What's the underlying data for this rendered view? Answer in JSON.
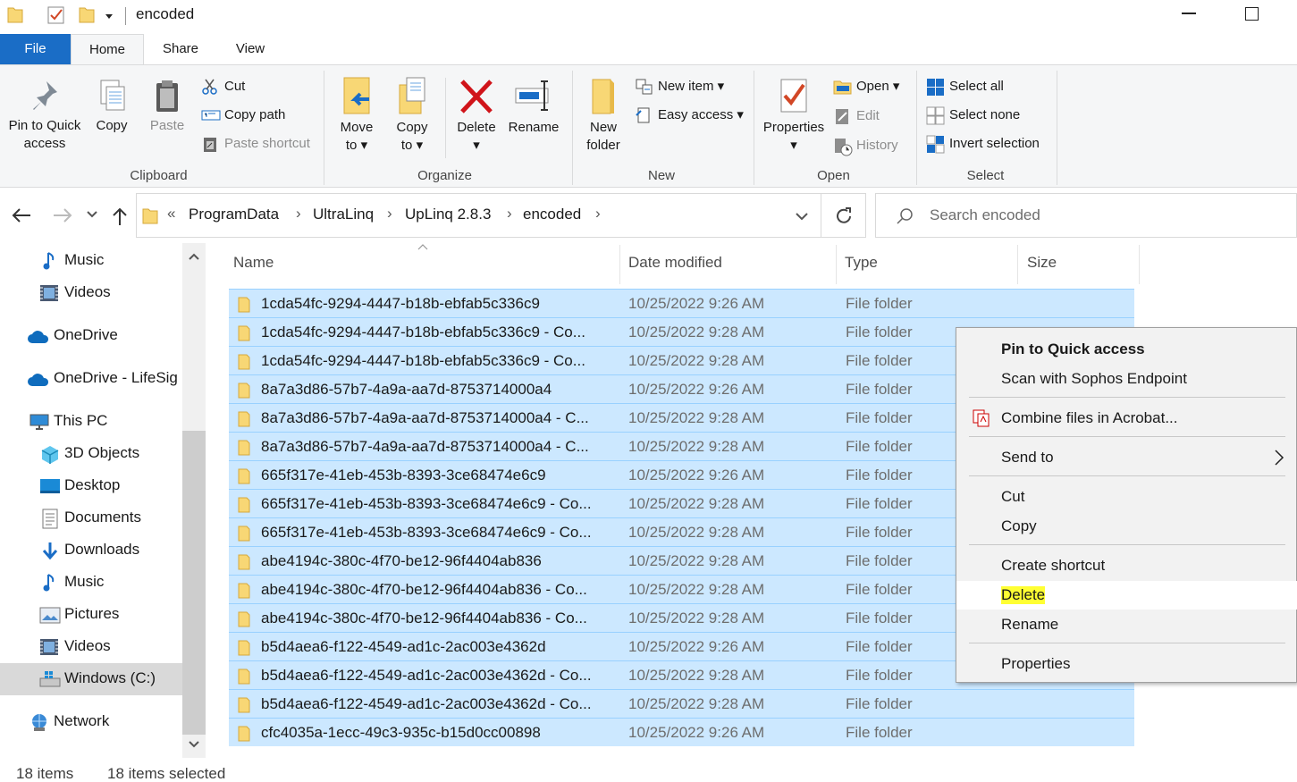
{
  "window": {
    "title": "encoded"
  },
  "tabs": {
    "file": "File",
    "home": "Home",
    "share": "Share",
    "view": "View"
  },
  "ribbon": {
    "clipboard": {
      "label": "Clipboard",
      "pin_line1": "Pin to Quick",
      "pin_line2": "access",
      "copy": "Copy",
      "paste": "Paste",
      "cut": "Cut",
      "copy_path": "Copy path",
      "paste_shortcut": "Paste shortcut"
    },
    "organize": {
      "label": "Organize",
      "move_line1": "Move",
      "move_line2": "to",
      "copy_line1": "Copy",
      "copy_line2": "to",
      "delete": "Delete",
      "rename": "Rename"
    },
    "new": {
      "label": "New",
      "folder_line1": "New",
      "folder_line2": "folder",
      "new_item": "New item",
      "easy_access": "Easy access"
    },
    "open": {
      "label": "Open",
      "properties": "Properties",
      "open": "Open",
      "edit": "Edit",
      "history": "History"
    },
    "select": {
      "label": "Select",
      "select_all": "Select all",
      "select_none": "Select none",
      "invert": "Invert selection"
    }
  },
  "address": {
    "prefix": "«",
    "crumbs": [
      "ProgramData",
      "UltraLinq",
      "UpLinq 2.8.3",
      "encoded"
    ],
    "search_placeholder": "Search encoded"
  },
  "nav_pane": {
    "items": [
      {
        "label": "Music",
        "icon": "music-icon"
      },
      {
        "label": "Videos",
        "icon": "videos-icon"
      },
      {
        "label": "OneDrive",
        "icon": "cloud-icon"
      },
      {
        "label": "OneDrive - LifeSig",
        "icon": "cloud-icon"
      },
      {
        "label": "This PC",
        "icon": "pc-icon"
      },
      {
        "label": "3D Objects",
        "icon": "cube-icon"
      },
      {
        "label": "Desktop",
        "icon": "desktop-icon"
      },
      {
        "label": "Documents",
        "icon": "documents-icon"
      },
      {
        "label": "Downloads",
        "icon": "downloads-icon"
      },
      {
        "label": "Music",
        "icon": "music-icon"
      },
      {
        "label": "Pictures",
        "icon": "pictures-icon"
      },
      {
        "label": "Videos",
        "icon": "videos-icon"
      },
      {
        "label": "Windows (C:)",
        "icon": "drive-icon"
      },
      {
        "label": "Network",
        "icon": "network-icon"
      }
    ]
  },
  "columns": {
    "name": "Name",
    "date": "Date modified",
    "type": "Type",
    "size": "Size"
  },
  "files": [
    {
      "name": "1cda54fc-9294-4447-b18b-ebfab5c336c9",
      "date": "10/25/2022 9:26 AM",
      "type": "File folder"
    },
    {
      "name": "1cda54fc-9294-4447-b18b-ebfab5c336c9 - Co...",
      "date": "10/25/2022 9:28 AM",
      "type": "File folder"
    },
    {
      "name": "1cda54fc-9294-4447-b18b-ebfab5c336c9 - Co...",
      "date": "10/25/2022 9:28 AM",
      "type": "File folder"
    },
    {
      "name": "8a7a3d86-57b7-4a9a-aa7d-8753714000a4",
      "date": "10/25/2022 9:26 AM",
      "type": "File folder"
    },
    {
      "name": "8a7a3d86-57b7-4a9a-aa7d-8753714000a4 - C...",
      "date": "10/25/2022 9:28 AM",
      "type": "File folder"
    },
    {
      "name": "8a7a3d86-57b7-4a9a-aa7d-8753714000a4 - C...",
      "date": "10/25/2022 9:28 AM",
      "type": "File folder"
    },
    {
      "name": "665f317e-41eb-453b-8393-3ce68474e6c9",
      "date": "10/25/2022 9:26 AM",
      "type": "File folder"
    },
    {
      "name": "665f317e-41eb-453b-8393-3ce68474e6c9 - Co...",
      "date": "10/25/2022 9:28 AM",
      "type": "File folder"
    },
    {
      "name": "665f317e-41eb-453b-8393-3ce68474e6c9 - Co...",
      "date": "10/25/2022 9:28 AM",
      "type": "File folder"
    },
    {
      "name": "abe4194c-380c-4f70-be12-96f4404ab836",
      "date": "10/25/2022 9:28 AM",
      "type": "File folder"
    },
    {
      "name": "abe4194c-380c-4f70-be12-96f4404ab836 - Co...",
      "date": "10/25/2022 9:28 AM",
      "type": "File folder"
    },
    {
      "name": "abe4194c-380c-4f70-be12-96f4404ab836 - Co...",
      "date": "10/25/2022 9:28 AM",
      "type": "File folder"
    },
    {
      "name": "b5d4aea6-f122-4549-ad1c-2ac003e4362d",
      "date": "10/25/2022 9:26 AM",
      "type": "File folder"
    },
    {
      "name": "b5d4aea6-f122-4549-ad1c-2ac003e4362d - Co...",
      "date": "10/25/2022 9:28 AM",
      "type": "File folder"
    },
    {
      "name": "b5d4aea6-f122-4549-ad1c-2ac003e4362d - Co...",
      "date": "10/25/2022 9:28 AM",
      "type": "File folder"
    },
    {
      "name": "cfc4035a-1ecc-49c3-935c-b15d0cc00898",
      "date": "10/25/2022 9:26 AM",
      "type": "File folder"
    }
  ],
  "status": {
    "count": "18 items",
    "selected": "18 items selected"
  },
  "context_menu": {
    "pin": "Pin to Quick access",
    "scan": "Scan with Sophos Endpoint",
    "combine": "Combine files in Acrobat...",
    "send_to": "Send to",
    "cut": "Cut",
    "copy": "Copy",
    "create_shortcut": "Create shortcut",
    "delete": "Delete",
    "rename": "Rename",
    "properties": "Properties"
  },
  "colors": {
    "accent": "#1a6dc6",
    "selection": "#cce8ff",
    "folder": "#f8d775",
    "highlight": "#ffff33"
  }
}
